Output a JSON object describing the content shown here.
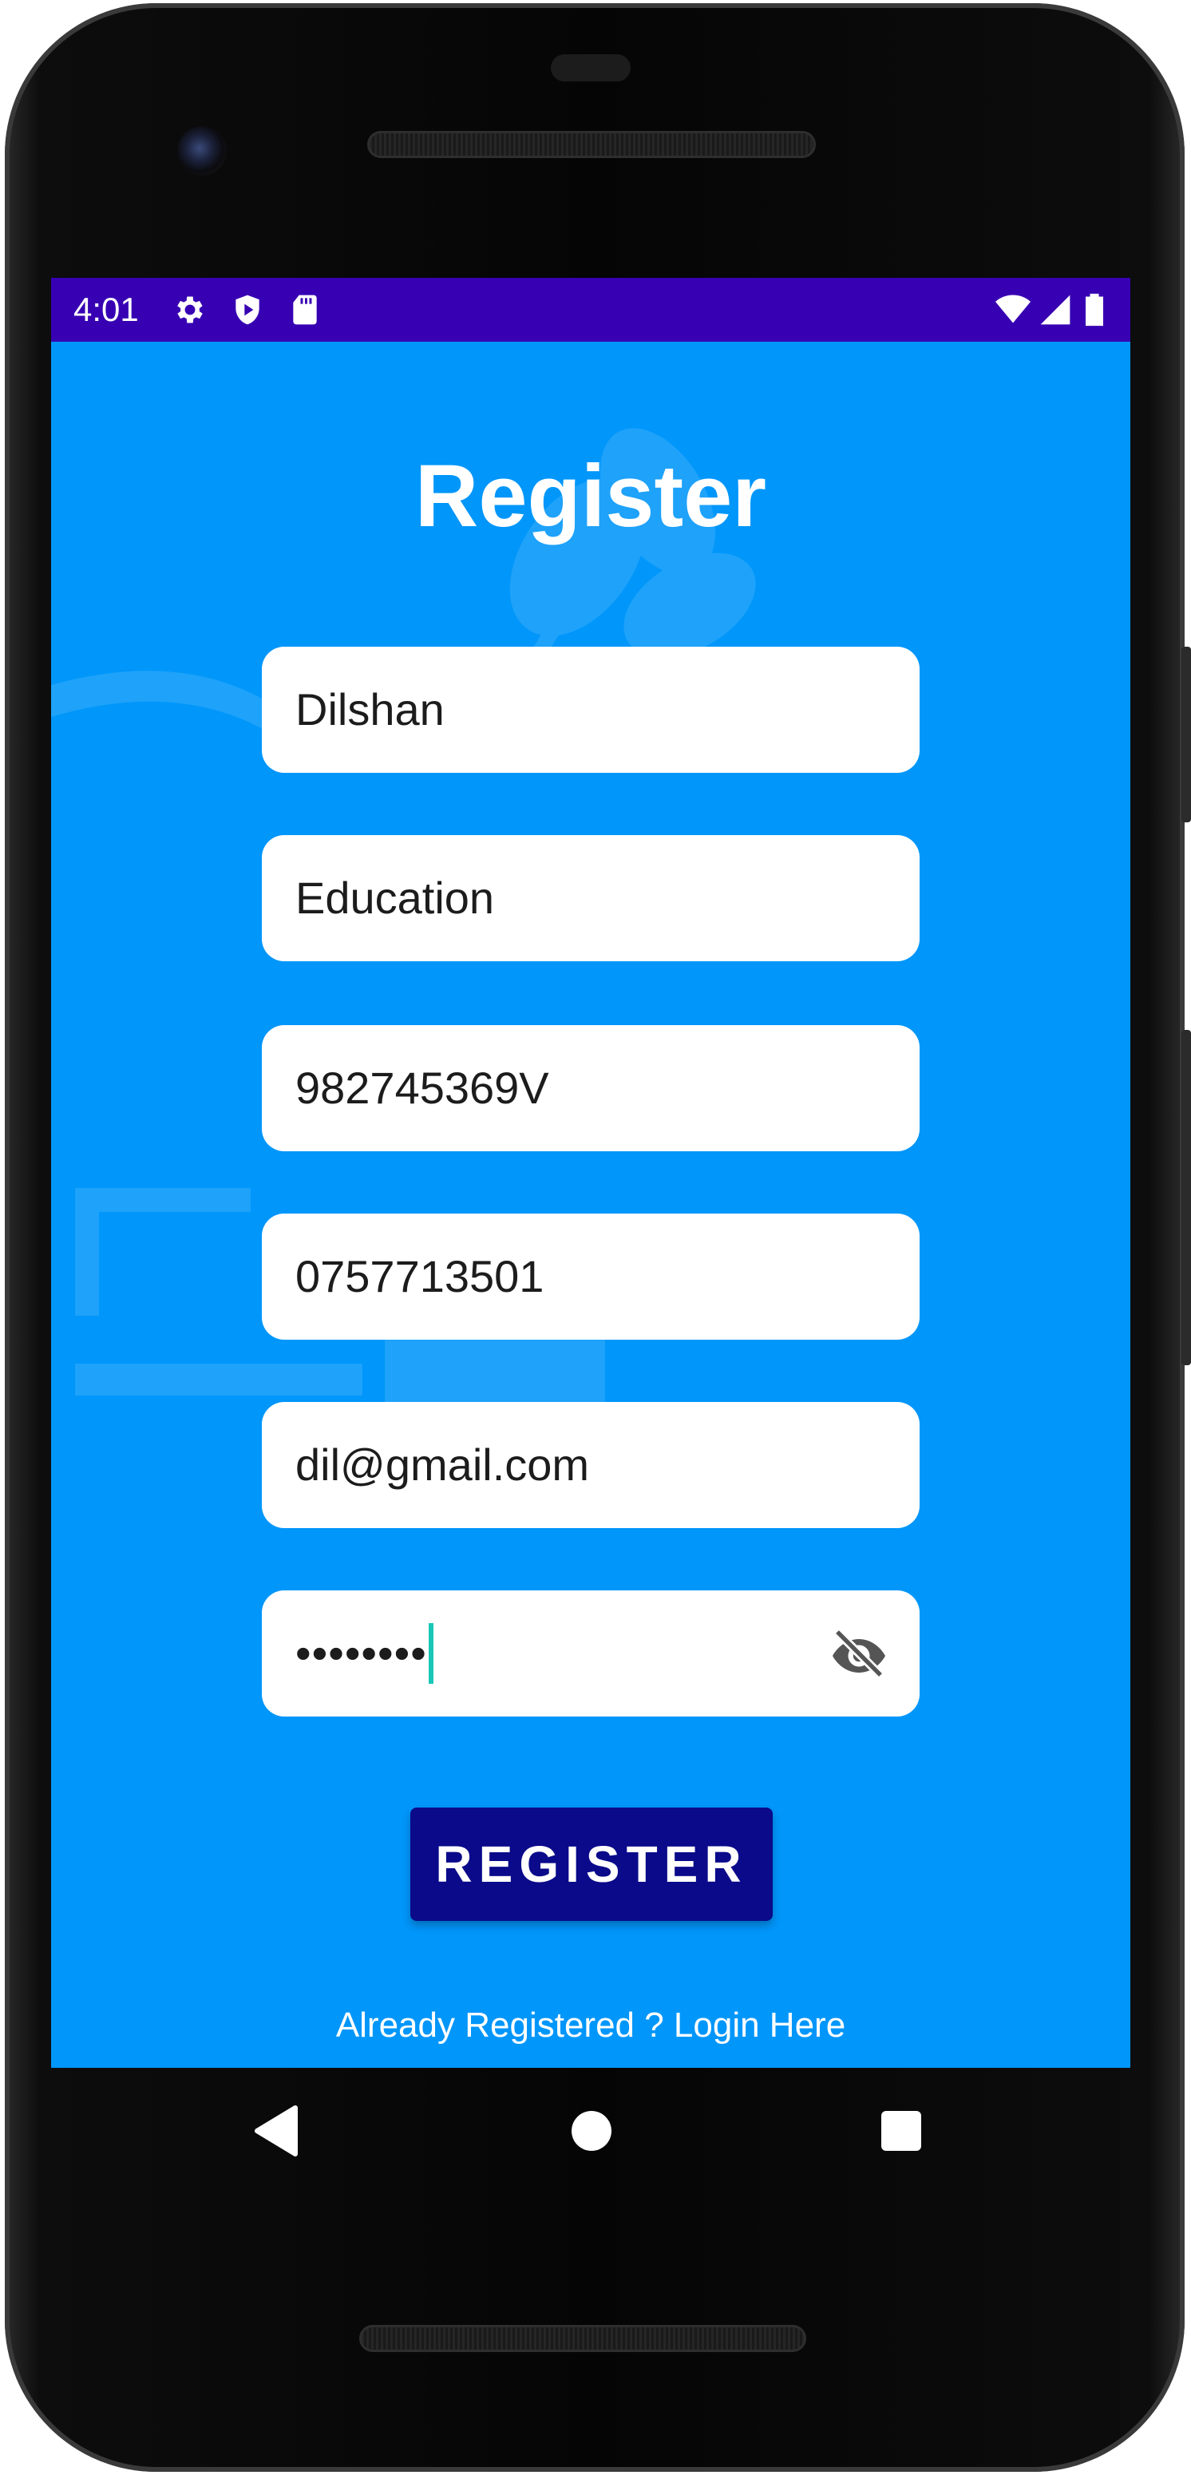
{
  "status_bar": {
    "time": "4:01",
    "left_icons": [
      "gear-icon",
      "shield-play-icon",
      "sd-card-icon"
    ],
    "right_icons": [
      "wifi-icon",
      "cell-signal-icon",
      "battery-icon"
    ],
    "background": "#3700B3"
  },
  "screen": {
    "background": "#0096FA"
  },
  "register_form": {
    "title": "Register",
    "fields": [
      {
        "name": "name",
        "value": "Dilshan"
      },
      {
        "name": "category",
        "value": "Education"
      },
      {
        "name": "nic",
        "value": "982745369V"
      },
      {
        "name": "phone",
        "value": "0757713501"
      },
      {
        "name": "email",
        "value": "dil@gmail.com"
      },
      {
        "name": "password",
        "value": "••••••••",
        "toggle_icon": "eye-off-icon"
      }
    ],
    "submit_label": "REGISTER",
    "submit_color": "#0A0A8A",
    "login_link": "Already Registered ? Login Here"
  },
  "nav_bar": {
    "icons": [
      "back-icon",
      "home-icon",
      "recents-icon"
    ]
  }
}
